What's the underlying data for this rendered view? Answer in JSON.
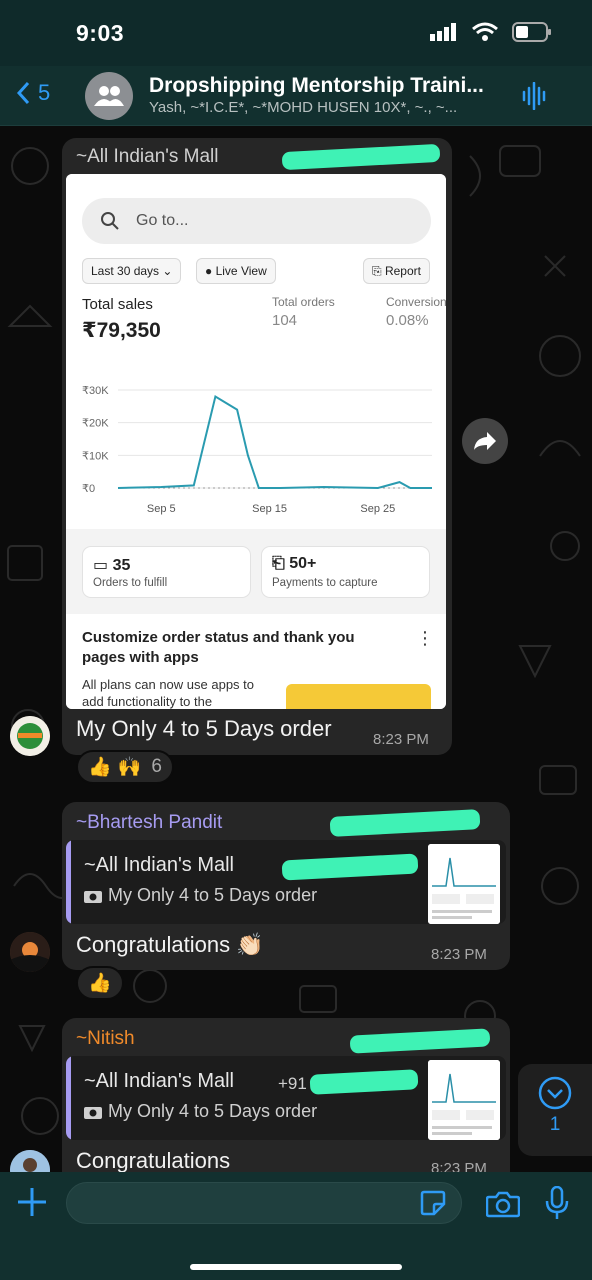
{
  "status_bar": {
    "time": "9:03"
  },
  "header": {
    "back_count": "5",
    "group_name": "Dropshipping Mentorship Traini...",
    "members": "Yash, ~*I.C.E*, ~*MOHD HUSEN 10X*, ~., ~..."
  },
  "messages": [
    {
      "sender": "~All Indian's Mall",
      "sender_color": "#d0d0d0",
      "text": "My Only 4 to 5 Days order",
      "time": "8:23 PM",
      "reactions": {
        "emoji": [
          "👍",
          "🙌"
        ],
        "count": "6"
      },
      "screenshot": {
        "search_placeholder": "Go to...",
        "filter_range": "Last 30 days",
        "live_view": "Live View",
        "report": "Report",
        "total_sales_label": "Total sales",
        "total_sales_value": "₹79,350",
        "total_orders_label": "Total orders",
        "total_orders_value": "104",
        "conversion_label": "Conversion",
        "conversion_value": "0.08%",
        "cards": [
          {
            "value": "35",
            "label": "Orders to fulfill"
          },
          {
            "value": "50+",
            "label": "Payments to capture"
          }
        ],
        "promo_title": "Customize order status and thank you pages with apps",
        "promo_body": "All plans can now use apps to add functionality to the"
      }
    },
    {
      "sender": "~Bhartesh Pandit",
      "sender_color": "#a79cf2",
      "quote_sender": "~All Indian's Mall",
      "quote_text": "My Only 4 to 5 Days order",
      "text": "Congratulations 👏🏻",
      "time": "8:23 PM",
      "reactions": {
        "emoji": [
          "👍"
        ]
      }
    },
    {
      "sender": "~Nitish",
      "sender_color": "#f08a2a",
      "quote_sender": "~All Indian's Mall",
      "quote_phone": "+91",
      "quote_text": "My Only 4 to 5 Days order",
      "text": "Congratulations",
      "time": "8:23 PM"
    }
  ],
  "scroll_to_bottom": {
    "unread": "1"
  },
  "chart_data": {
    "type": "line",
    "title": "",
    "x_tick_labels": [
      "Sep 5",
      "Sep 15",
      "Sep 25"
    ],
    "y_tick_labels": [
      "₹30K",
      "₹20K",
      "₹10K",
      "₹0"
    ],
    "ylim": [
      0,
      30000
    ],
    "x": [
      "Sep 1",
      "Sep 5",
      "Sep 8",
      "Sep 10",
      "Sep 11",
      "Sep 12",
      "Sep 13",
      "Sep 14",
      "Sep 16",
      "Sep 20",
      "Sep 25",
      "Sep 27",
      "Sep 28",
      "Sep 30"
    ],
    "series": [
      {
        "values": [
          0,
          300,
          800,
          28000,
          26000,
          24000,
          10000,
          0,
          0,
          300,
          0,
          1800,
          0,
          0
        ]
      }
    ]
  },
  "colors": {
    "accent": "#2f9bf5",
    "highlight_mask": "#3ff2b5",
    "bubble": "#262626",
    "header": "#12302f"
  }
}
